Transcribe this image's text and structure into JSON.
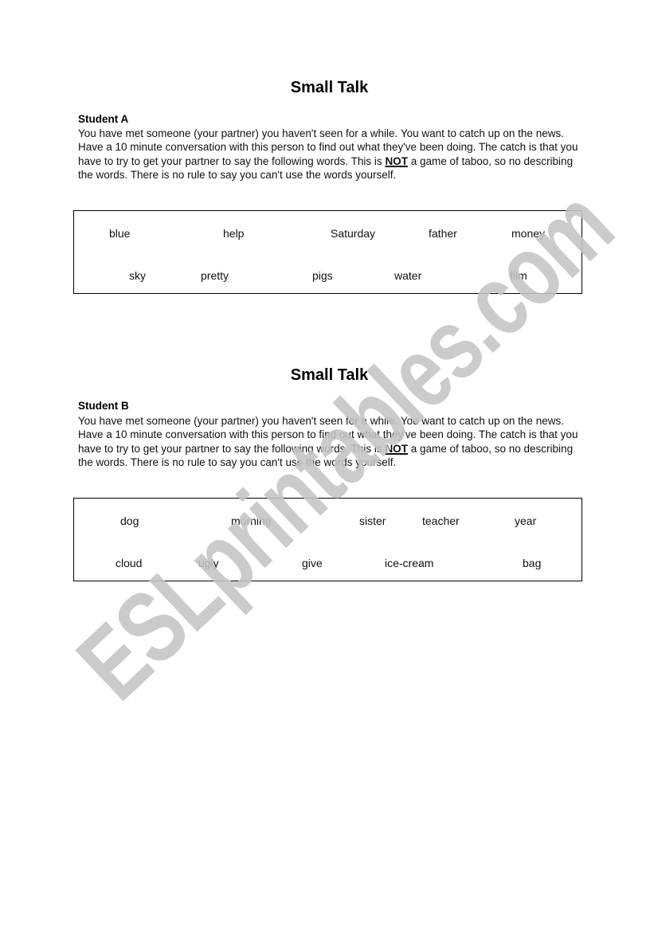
{
  "watermark": {
    "text": "ESLprintables.com"
  },
  "worksheets": [
    {
      "title": "Small Talk",
      "student_label": "Student A",
      "instructions": {
        "part1": "You have met someone (your partner) you haven't seen for a while.  You want to catch up on the news.  Have a 10 minute conversation with this person to find out what they've been doing.  The catch is that you have to try to get your partner to say the following words.  This is ",
        "emphasis": "NOT",
        "part2": " a game of taboo, so no describing the words.  There is no rule to say you can't use the words yourself."
      },
      "words_row1": [
        "blue",
        "help",
        "Saturday",
        "father",
        "money"
      ],
      "words_row2": [
        "sky",
        "pretty",
        "pigs",
        "water",
        "film"
      ]
    },
    {
      "title": "Small Talk",
      "student_label": "Student B",
      "instructions": {
        "part1": "You have met someone (your partner) you haven't seen for a while.  You want to catch up on the news.  Have a 10 minute conversation with this person to find out what they've been doing.  The catch is that you have to try to get your partner to say the following words.  This is ",
        "emphasis": "NOT",
        "part2": " a game of taboo, so no describing the words.  There is no rule to say you can't use the words yourself."
      },
      "words_row1": [
        "dog",
        "morning",
        "sister",
        "teacher",
        "year"
      ],
      "words_row2": [
        "cloud",
        "ugly",
        "give",
        "ice-cream",
        "bag"
      ]
    }
  ]
}
